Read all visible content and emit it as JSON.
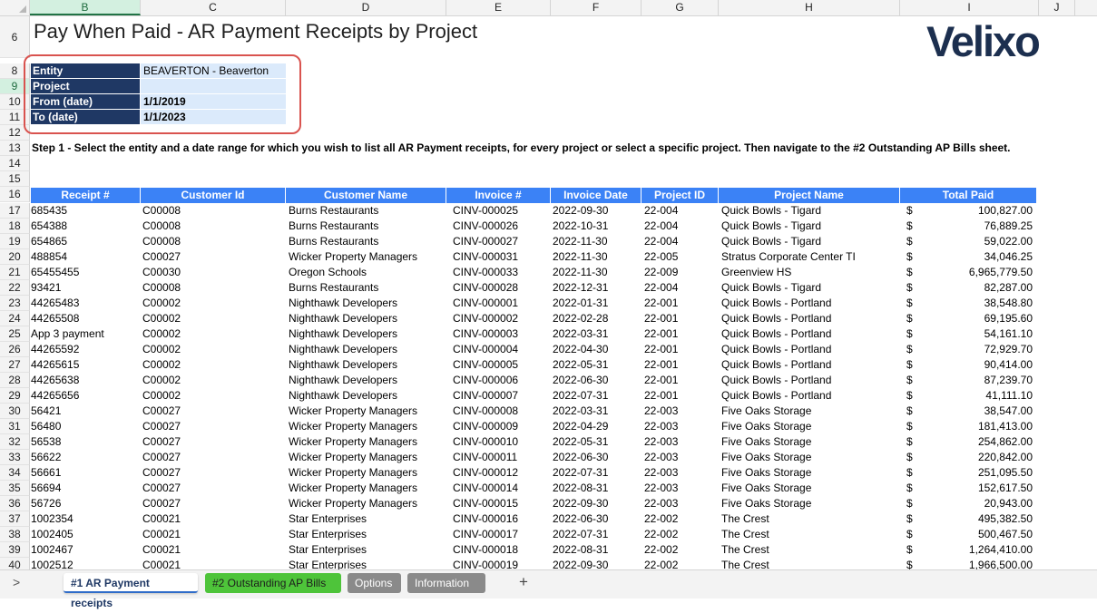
{
  "columns": [
    "B",
    "C",
    "D",
    "E",
    "F",
    "G",
    "H",
    "I",
    "J"
  ],
  "selected_column": "B",
  "sheet": {
    "title": "Pay When Paid - AR Payment Receipts by Project",
    "logo_text": "Velixo",
    "row_numbers": {
      "title": "6",
      "params": [
        "8",
        "9",
        "10",
        "11"
      ],
      "blank_12": "12",
      "instruction": "13",
      "blanks": [
        "14",
        "15"
      ],
      "header": "16",
      "selected_row": "9"
    },
    "parameters": [
      {
        "label": "Entity",
        "value": "BEAVERTON - Beaverton",
        "bold": false
      },
      {
        "label": "Project",
        "value": "",
        "bold": false
      },
      {
        "label": "From (date)",
        "value": "1/1/2019",
        "bold": true
      },
      {
        "label": "To (date)",
        "value": "1/1/2023",
        "bold": true
      }
    ],
    "instruction": "Step 1 - Select the entity and a date range for which you wish to list all AR Payment receipts, for every project or select a specific project. Then navigate to the #2 Outstanding AP Bills sheet.",
    "table_headers": [
      "Receipt #",
      "Customer Id",
      "Customer Name",
      "Invoice #",
      "Invoice Date",
      "Project ID",
      "Project Name",
      "Total Paid"
    ],
    "currency_symbol": "$",
    "rows": [
      {
        "n": "17",
        "receipt": "685435",
        "cust_id": "C00008",
        "cust_name": "Burns Restaurants",
        "invoice": "CINV-000025",
        "date": "2022-09-30",
        "project_id": "22-004",
        "project_name": "Quick Bowls - Tigard",
        "total": "100,827.00"
      },
      {
        "n": "18",
        "receipt": "654388",
        "cust_id": "C00008",
        "cust_name": "Burns Restaurants",
        "invoice": "CINV-000026",
        "date": "2022-10-31",
        "project_id": "22-004",
        "project_name": "Quick Bowls - Tigard",
        "total": "76,889.25"
      },
      {
        "n": "19",
        "receipt": "654865",
        "cust_id": "C00008",
        "cust_name": "Burns Restaurants",
        "invoice": "CINV-000027",
        "date": "2022-11-30",
        "project_id": "22-004",
        "project_name": "Quick Bowls - Tigard",
        "total": "59,022.00"
      },
      {
        "n": "20",
        "receipt": "488854",
        "cust_id": "C00027",
        "cust_name": "Wicker Property Managers",
        "invoice": "CINV-000031",
        "date": "2022-11-30",
        "project_id": "22-005",
        "project_name": "Stratus Corporate Center TI",
        "total": "34,046.25"
      },
      {
        "n": "21",
        "receipt": "65455455",
        "cust_id": "C00030",
        "cust_name": "Oregon Schools",
        "invoice": "CINV-000033",
        "date": "2022-11-30",
        "project_id": "22-009",
        "project_name": "Greenview HS",
        "total": "6,965,779.50"
      },
      {
        "n": "22",
        "receipt": "93421",
        "cust_id": "C00008",
        "cust_name": "Burns Restaurants",
        "invoice": "CINV-000028",
        "date": "2022-12-31",
        "project_id": "22-004",
        "project_name": "Quick Bowls - Tigard",
        "total": "82,287.00"
      },
      {
        "n": "23",
        "receipt": "44265483",
        "cust_id": "C00002",
        "cust_name": "Nighthawk Developers",
        "invoice": "CINV-000001",
        "date": "2022-01-31",
        "project_id": "22-001",
        "project_name": "Quick Bowls - Portland",
        "total": "38,548.80"
      },
      {
        "n": "24",
        "receipt": "44265508",
        "cust_id": "C00002",
        "cust_name": "Nighthawk Developers",
        "invoice": "CINV-000002",
        "date": "2022-02-28",
        "project_id": "22-001",
        "project_name": "Quick Bowls - Portland",
        "total": "69,195.60"
      },
      {
        "n": "25",
        "receipt": "App 3 payment",
        "cust_id": "C00002",
        "cust_name": "Nighthawk Developers",
        "invoice": "CINV-000003",
        "date": "2022-03-31",
        "project_id": "22-001",
        "project_name": "Quick Bowls - Portland",
        "total": "54,161.10"
      },
      {
        "n": "26",
        "receipt": "44265592",
        "cust_id": "C00002",
        "cust_name": "Nighthawk Developers",
        "invoice": "CINV-000004",
        "date": "2022-04-30",
        "project_id": "22-001",
        "project_name": "Quick Bowls - Portland",
        "total": "72,929.70"
      },
      {
        "n": "27",
        "receipt": "44265615",
        "cust_id": "C00002",
        "cust_name": "Nighthawk Developers",
        "invoice": "CINV-000005",
        "date": "2022-05-31",
        "project_id": "22-001",
        "project_name": "Quick Bowls - Portland",
        "total": "90,414.00"
      },
      {
        "n": "28",
        "receipt": "44265638",
        "cust_id": "C00002",
        "cust_name": "Nighthawk Developers",
        "invoice": "CINV-000006",
        "date": "2022-06-30",
        "project_id": "22-001",
        "project_name": "Quick Bowls - Portland",
        "total": "87,239.70"
      },
      {
        "n": "29",
        "receipt": "44265656",
        "cust_id": "C00002",
        "cust_name": "Nighthawk Developers",
        "invoice": "CINV-000007",
        "date": "2022-07-31",
        "project_id": "22-001",
        "project_name": "Quick Bowls - Portland",
        "total": "41,111.10"
      },
      {
        "n": "30",
        "receipt": "56421",
        "cust_id": "C00027",
        "cust_name": "Wicker Property Managers",
        "invoice": "CINV-000008",
        "date": "2022-03-31",
        "project_id": "22-003",
        "project_name": "Five Oaks Storage",
        "total": "38,547.00"
      },
      {
        "n": "31",
        "receipt": "56480",
        "cust_id": "C00027",
        "cust_name": "Wicker Property Managers",
        "invoice": "CINV-000009",
        "date": "2022-04-29",
        "project_id": "22-003",
        "project_name": "Five Oaks Storage",
        "total": "181,413.00"
      },
      {
        "n": "32",
        "receipt": "56538",
        "cust_id": "C00027",
        "cust_name": "Wicker Property Managers",
        "invoice": "CINV-000010",
        "date": "2022-05-31",
        "project_id": "22-003",
        "project_name": "Five Oaks Storage",
        "total": "254,862.00"
      },
      {
        "n": "33",
        "receipt": "56622",
        "cust_id": "C00027",
        "cust_name": "Wicker Property Managers",
        "invoice": "CINV-000011",
        "date": "2022-06-30",
        "project_id": "22-003",
        "project_name": "Five Oaks Storage",
        "total": "220,842.00"
      },
      {
        "n": "34",
        "receipt": "56661",
        "cust_id": "C00027",
        "cust_name": "Wicker Property Managers",
        "invoice": "CINV-000012",
        "date": "2022-07-31",
        "project_id": "22-003",
        "project_name": "Five Oaks Storage",
        "total": "251,095.50"
      },
      {
        "n": "35",
        "receipt": "56694",
        "cust_id": "C00027",
        "cust_name": "Wicker Property Managers",
        "invoice": "CINV-000014",
        "date": "2022-08-31",
        "project_id": "22-003",
        "project_name": "Five Oaks Storage",
        "total": "152,617.50"
      },
      {
        "n": "36",
        "receipt": "56726",
        "cust_id": "C00027",
        "cust_name": "Wicker Property Managers",
        "invoice": "CINV-000015",
        "date": "2022-09-30",
        "project_id": "22-003",
        "project_name": "Five Oaks Storage",
        "total": "20,943.00"
      },
      {
        "n": "37",
        "receipt": "1002354",
        "cust_id": "C00021",
        "cust_name": "Star Enterprises",
        "invoice": "CINV-000016",
        "date": "2022-06-30",
        "project_id": "22-002",
        "project_name": "The Crest",
        "total": "495,382.50"
      },
      {
        "n": "38",
        "receipt": "1002405",
        "cust_id": "C00021",
        "cust_name": "Star Enterprises",
        "invoice": "CINV-000017",
        "date": "2022-07-31",
        "project_id": "22-002",
        "project_name": "The Crest",
        "total": "500,467.50"
      },
      {
        "n": "39",
        "receipt": "1002467",
        "cust_id": "C00021",
        "cust_name": "Star Enterprises",
        "invoice": "CINV-000018",
        "date": "2022-08-31",
        "project_id": "22-002",
        "project_name": "The Crest",
        "total": "1,264,410.00"
      },
      {
        "n": "40",
        "receipt": "1002512",
        "cust_id": "C00021",
        "cust_name": "Star Enterprises",
        "invoice": "CINV-000019",
        "date": "2022-09-30",
        "project_id": "22-002",
        "project_name": "The Crest",
        "total": "1,966,500.00"
      }
    ]
  },
  "tabs": [
    {
      "label": "#1 AR Payment receipts",
      "style": "active"
    },
    {
      "label": "#2 Outstanding AP Bills",
      "style": "green"
    },
    {
      "label": "Options",
      "style": "gray"
    },
    {
      "label": "Information",
      "style": "gray"
    }
  ],
  "add_sheet_label": "+",
  "nav_label": ">",
  "colors": {
    "param_label_bg": "#1f3864",
    "param_value_bg": "#dbeafb",
    "header_bg": "#3b82f6",
    "highlight_box": "#d9534f",
    "selection": "#217346"
  }
}
